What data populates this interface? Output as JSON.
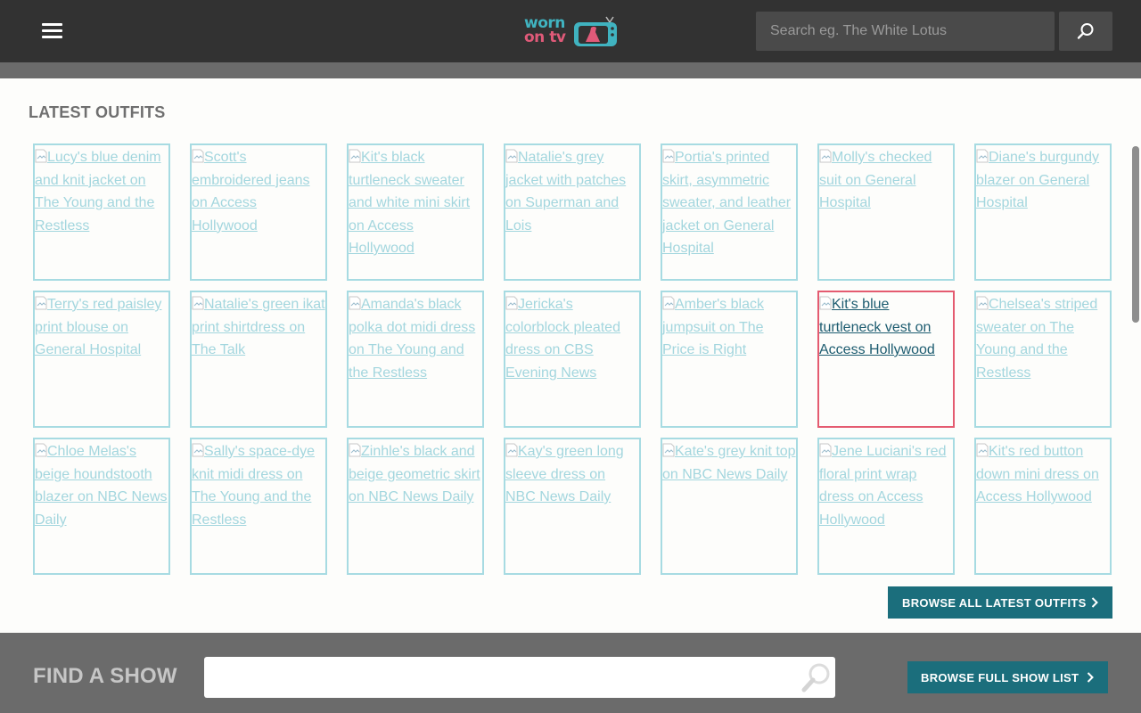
{
  "header": {
    "logo_line1": "worn",
    "logo_line2": "on tv",
    "search_placeholder": "Search eg. The White Lotus"
  },
  "latest": {
    "title": "LATEST OUTFITS",
    "browse_label": "BROWSE ALL LATEST OUTFITS",
    "items": [
      {
        "label": "Lucy's blue denim and knit jacket on The Young and the Restless"
      },
      {
        "label": "Scott's embroidered jeans on Access Hollywood"
      },
      {
        "label": "Kit's black turtleneck sweater and white mini skirt on Access Hollywood"
      },
      {
        "label": "Natalie's grey jacket with patches on Superman and Lois"
      },
      {
        "label": "Portia's printed skirt, asymmetric sweater, and leather jacket on General Hospital"
      },
      {
        "label": "Molly's checked suit on General Hospital"
      },
      {
        "label": "Diane's burgundy blazer on General Hospital"
      },
      {
        "label": "Terry's red paisley print blouse on General Hospital"
      },
      {
        "label": "Natalie's green ikat print shirtdress on The Talk"
      },
      {
        "label": "Amanda's black polka dot midi dress on The Young and the Restless"
      },
      {
        "label": "Jericka's colorblock pleated dress on CBS Evening News"
      },
      {
        "label": "Amber's black jumpsuit on The Price is Right"
      },
      {
        "label": "Kit's blue turtleneck vest on Access Hollywood"
      },
      {
        "label": "Chelsea's striped sweater on The Young and the Restless"
      },
      {
        "label": "Chloe Melas's beige houndstooth blazer on NBC News Daily"
      },
      {
        "label": "Sally's space-dye knit midi dress on The Young and the Restless"
      },
      {
        "label": "Zinhle's black and beige geometric skirt on NBC News Daily"
      },
      {
        "label": "Kay's green long sleeve dress on NBC News Daily"
      },
      {
        "label": "Kate's grey knit top on NBC News Daily"
      },
      {
        "label": "Jene Luciani's red floral print wrap dress on Access Hollywood"
      },
      {
        "label": "Kit's red button down mini dress on Access Hollywood"
      }
    ]
  },
  "find_show": {
    "title": "FIND A SHOW",
    "input_value": "",
    "browse_label": "BROWSE FULL SHOW LIST"
  },
  "colors": {
    "topbar": "#323232",
    "accent": "#1b6e7c",
    "tile_border": "#a7dbe2",
    "tile_active_border": "#e45b70",
    "logo_blue": "#40b3c0",
    "logo_pink": "#e05a79"
  }
}
